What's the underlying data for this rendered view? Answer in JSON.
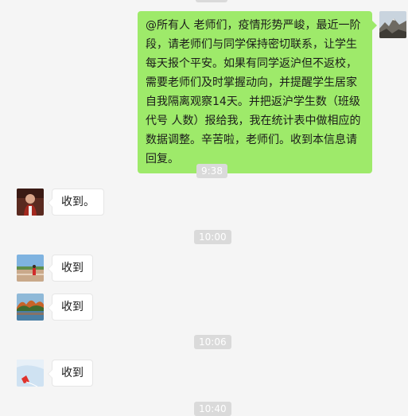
{
  "outgoing": {
    "text_lines": [
      "@所有人  老师们，疫情形势严峻，最近一阶",
      "段，请老师们与同学保持密切联系，让学生",
      "每天报个平安。如果有同学返沪但不返校，",
      "需要老师们及时掌握动向，并提醒学生居家",
      "自我隔离观察14天。并把返沪学生数（班级",
      "代号 人数）报给我，我在统计表中做相应的",
      "数据调整。辛苦啦，老师们。收到本信息请",
      "回复。"
    ]
  },
  "timestamps": [
    "9:38",
    "10:00",
    "10:06",
    "10:40"
  ],
  "replies": [
    {
      "text": "收到。",
      "avatar": "avatar-portrait"
    },
    {
      "text": "收到",
      "avatar": "avatar-track-field"
    },
    {
      "text": "收到",
      "avatar": "avatar-autumn-lake"
    },
    {
      "text": "收到",
      "avatar": "avatar-sky-kite"
    }
  ],
  "colors": {
    "background": "#f5f5f5",
    "outgoing_bubble": "#9eea6a",
    "incoming_bubble": "#ffffff",
    "timestamp_chip": "#dadada"
  }
}
